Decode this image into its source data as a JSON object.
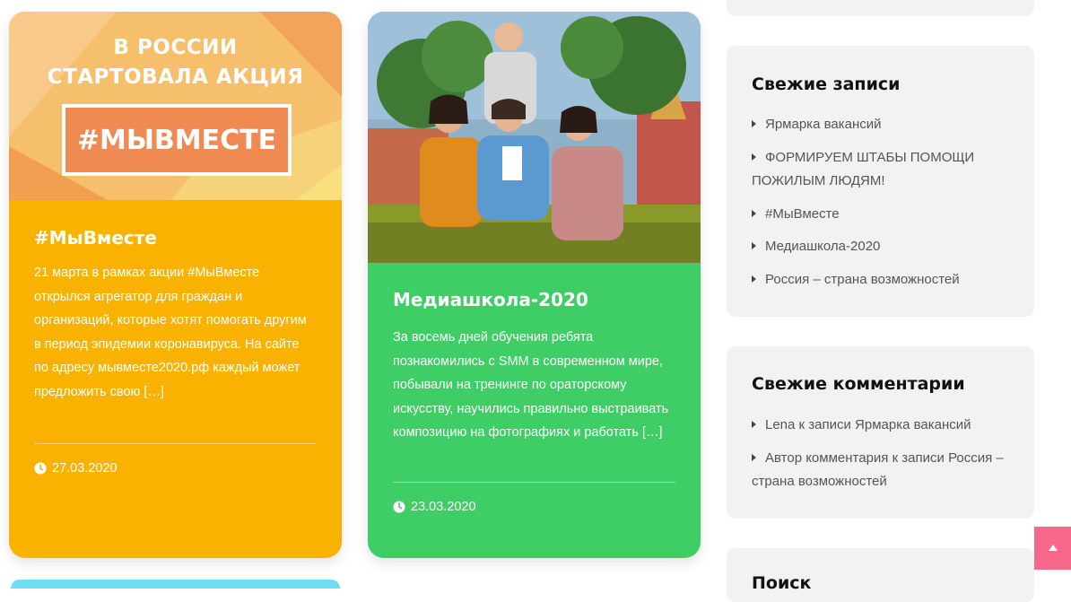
{
  "colors": {
    "card1_bg": "#f9b200",
    "card2_bg": "#3fcd66",
    "widget_bg": "#f2f2f2",
    "accent_pink": "#f7698c"
  },
  "posts": [
    {
      "banner": {
        "line1": "В РОССИИ",
        "line2": "СТАРТОВАЛА АКЦИЯ",
        "tag": "#МЫВМЕСТЕ"
      },
      "title": "#МыВместе",
      "excerpt": "21 марта в рамках акции #МыВместе открылся агрегатор для граждан и организаций, которые хотят помогать другим в период эпидемии коронавируса. На сайте по адресу мывместе2020.рф каждый может предложить свою […]",
      "date": "27.03.2020",
      "date_icon": "clock-icon"
    },
    {
      "title": "Медиашкола-2020",
      "excerpt": "За восемь дней обучения ребята познакомились с SMM в современном мире, побывали на тренинге по ораторскому искусству, научились правильно выстраивать композицию на фотографиях и работать […]",
      "date": "23.03.2020",
      "date_icon": "clock-icon"
    }
  ],
  "sidebar": {
    "recent_posts": {
      "title": "Свежие записи",
      "items": [
        "Ярмарка вакансий",
        "ФОРМИРУЕМ ШТАБЫ ПОМОЩИ ПОЖИЛЫМ ЛЮДЯМ!",
        "#МыВместе",
        "Медиашкола-2020",
        "Россия – страна возможностей"
      ]
    },
    "recent_comments": {
      "title": "Свежие комментарии",
      "items": [
        "Lena к записи Ярмарка вакансий",
        "Автор комментария к записи Россия – страна возможностей"
      ]
    },
    "search": {
      "title": "Поиск"
    }
  },
  "scroll_top_icon": "chevron-up-icon"
}
